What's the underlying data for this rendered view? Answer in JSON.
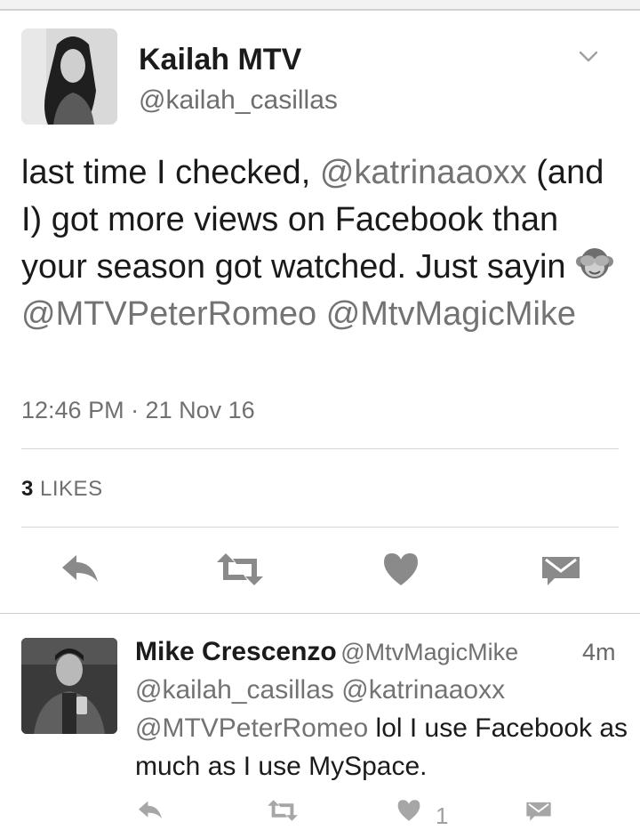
{
  "tweet": {
    "author_name": "Kailah MTV",
    "author_handle": "@kailah_casillas",
    "text": {
      "p1": "last time I checked, ",
      "m1": "@katrinaaoxx",
      "p2": " (and I) got more views on Facebook than your season got watched. Just sayin ",
      "emoji": "see-no-evil-monkey",
      "p3": " ",
      "m2": "@MTVPeterRomeo",
      "p4": " ",
      "m3": "@MtvMagicMike"
    },
    "timestamp": "12:46 PM · 21 Nov 16",
    "likes_count": "3",
    "likes_label": "LIKES",
    "actions": [
      "reply-icon",
      "retweet-icon",
      "like-icon",
      "message-icon"
    ],
    "menu_icon": "chevron-down-icon"
  },
  "reply": {
    "author_name": "Mike Crescenzo",
    "author_handle": "@MtvMagicMike",
    "time": "4m",
    "text": {
      "m1": "@kailah_casillas",
      "p1": " ",
      "m2": "@katrinaaoxx",
      "p2": " ",
      "m3": "@MTVPeterRomeo",
      "p3": " lol I use Facebook as much as I use MySpace."
    },
    "like_count": "1",
    "actions": [
      "reply-icon",
      "retweet-icon",
      "like-icon",
      "message-icon"
    ]
  },
  "colors": {
    "text": "#1a1a1a",
    "secondary": "#707070",
    "icon": "#8a8a8a",
    "reply_icon": "#a6a6a6",
    "divider": "#d6d6d6"
  }
}
